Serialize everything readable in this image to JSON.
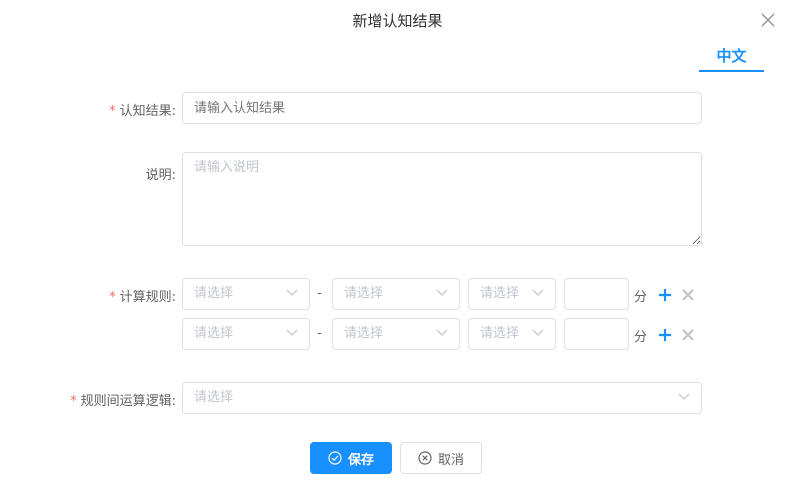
{
  "dialog": {
    "title": "新增认知结果",
    "close_icon": "close-icon"
  },
  "language_tab": "中文",
  "form": {
    "result": {
      "required": "*",
      "label": "认知结果:",
      "placeholder": "请输入认知结果",
      "value": ""
    },
    "description": {
      "label": "说明:",
      "placeholder": "请输入说明",
      "value": ""
    },
    "rules": {
      "required": "*",
      "label": "计算规则:",
      "separator": "-",
      "unit": "分",
      "rows": [
        {
          "select1": "请选择",
          "select2": "请选择",
          "select3": "请选择",
          "score": ""
        },
        {
          "select1": "请选择",
          "select2": "请选择",
          "select3": "请选择",
          "score": ""
        }
      ]
    },
    "logic": {
      "required": "*",
      "label": "规则间运算逻辑:",
      "placeholder": "请选择"
    }
  },
  "buttons": {
    "save": "保存",
    "cancel": "取消"
  },
  "colors": {
    "primary": "#1890ff",
    "required": "#f56c6c",
    "border": "#dcdfe6",
    "placeholder": "#c0c4cc",
    "delete_icon": "#c0c4cc"
  }
}
